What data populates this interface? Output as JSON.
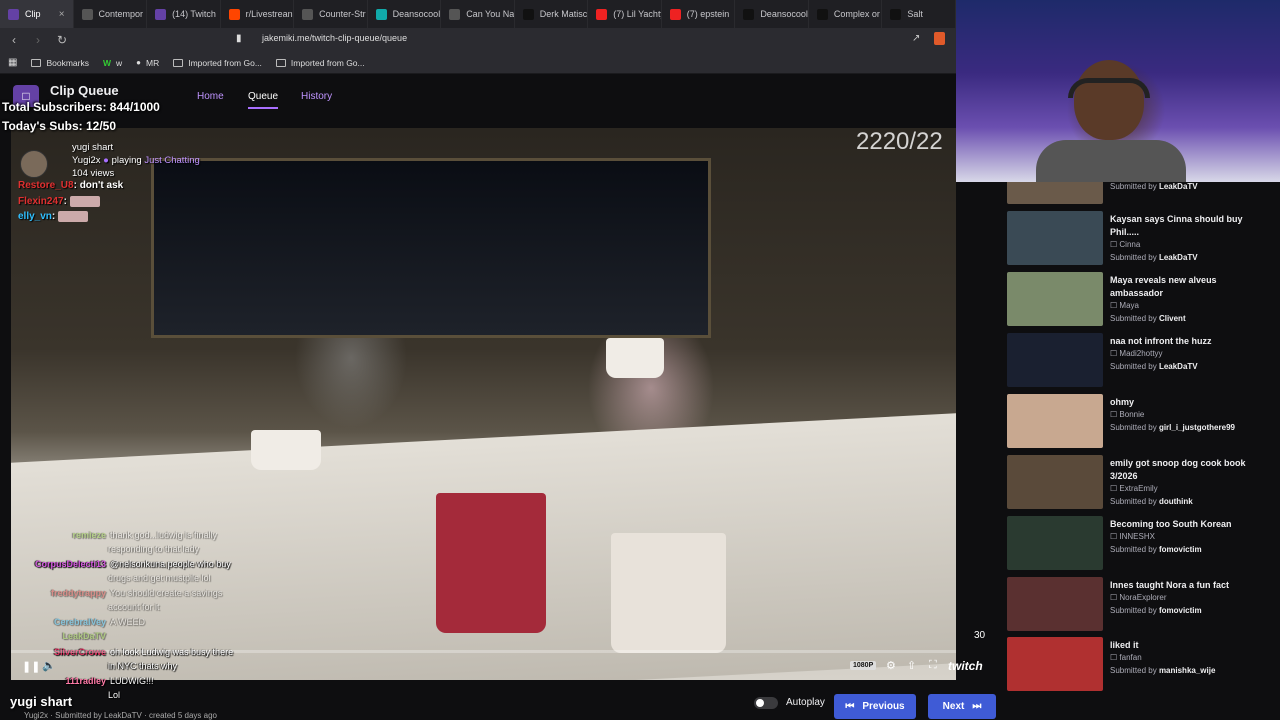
{
  "browser": {
    "tabs": [
      {
        "label": "Clip",
        "fav_color": "#6441a5",
        "active": true
      },
      {
        "label": "Contempor",
        "fav_color": "#555"
      },
      {
        "label": "(14) Twitch",
        "fav_color": "#6441a5"
      },
      {
        "label": "r/Livestrean",
        "fav_color": "#ff4500"
      },
      {
        "label": "Counter-Str",
        "fav_color": "#555"
      },
      {
        "label": "Deansocool",
        "fav_color": "#1aa"
      },
      {
        "label": "Can You Na",
        "fav_color": "#555"
      },
      {
        "label": "Derk Matisc",
        "fav_color": "#111"
      },
      {
        "label": "(7) Lil Yachty",
        "fav_color": "#e22"
      },
      {
        "label": "(7) epstein",
        "fav_color": "#e22"
      },
      {
        "label": "Deansocool",
        "fav_color": "#111"
      },
      {
        "label": "Complex or",
        "fav_color": "#111"
      },
      {
        "label": "Salt",
        "fav_color": "#111"
      }
    ],
    "url": "jakemiki.me/twitch-clip-queue/queue",
    "bookmarks": [
      {
        "label": "Bookmarks"
      },
      {
        "label": "w"
      },
      {
        "label": "MR"
      },
      {
        "label": "Imported from Go..."
      },
      {
        "label": "Imported from Go..."
      }
    ]
  },
  "app": {
    "title": "Clip Queue",
    "nav": {
      "home": "Home",
      "queue": "Queue",
      "history": "History"
    }
  },
  "overlay": {
    "total_subs": "Total Subscribers: 844/1000",
    "todays_subs": "Today's Subs: 12/50",
    "counter": "2220/22"
  },
  "clip": {
    "user": "yugi shart",
    "broadcaster": "Yugi2x",
    "playing_word": "playing",
    "game": "Just Chatting",
    "views": "104 views",
    "time_remaining": "30",
    "quality": "1080P",
    "progress_percent": 0,
    "footer_title": "yugi shart",
    "footer_meta": "Yugi2x · Submitted by LeakDaTV · created 5 days ago"
  },
  "chat_top": [
    {
      "name": "Restore_U8",
      "msg": "don't ask",
      "color": "#e03030"
    },
    {
      "name": "Flexin247",
      "msg": "",
      "color": "#e03030"
    },
    {
      "name": "elly_vn",
      "msg": "",
      "color": "#30c0ff"
    }
  ],
  "chat_bottom": [
    {
      "name": "remieze",
      "msg": "thank god...ludwig is finally",
      "color": "#8acd3a",
      "faded": true
    },
    {
      "name": "",
      "msg": "responding to that lady",
      "color": "#fff",
      "faded": true
    },
    {
      "name": "CorpusDelecti13",
      "msg": "@nelsonkuna people who buy",
      "color": "#d45ae0",
      "faded": false
    },
    {
      "name": "",
      "msg": "drugs and get mustpile lol",
      "color": "#fff",
      "faded": true
    },
    {
      "name": "freddytrappy",
      "msg": "You should create a savings",
      "color": "#e04040",
      "faded": true
    },
    {
      "name": "",
      "msg": "account for it",
      "color": "#fff",
      "faded": true
    },
    {
      "name": "CerebralVey",
      "msg": "A WEED",
      "color": "#30c0ff",
      "faded": true
    },
    {
      "name": "LeakDaTV",
      "msg": "",
      "color": "#8acd3a",
      "faded": true
    },
    {
      "name": "SilverCrowe",
      "msg": "oh look Ludwig was busy there",
      "color": "#e03060",
      "faded": false
    },
    {
      "name": "",
      "msg": "in NYC thats why",
      "color": "#fff",
      "faded": false
    },
    {
      "name": "111radley",
      "msg": "LUDWIG!!!",
      "color": "#ff7aa8",
      "faded": false
    },
    {
      "name": "",
      "msg": "Lol",
      "color": "#fff",
      "faded": false
    }
  ],
  "queue": [
    {
      "title": "",
      "author": "",
      "submitter": "LeakDaTV",
      "thumb": "#6a5a4a"
    },
    {
      "title": "Kaysan says Cinna should buy Phil.....",
      "author": "Cinna",
      "submitter": "LeakDaTV",
      "thumb": "#3a4a55"
    },
    {
      "title": "Maya reveals new alveus ambassador",
      "author": "Maya",
      "submitter": "Clivent",
      "thumb": "#7a8a6a"
    },
    {
      "title": "naa not infront the huzz",
      "author": "Madi2hottyy",
      "submitter": "LeakDaTV",
      "thumb": "#1a2030"
    },
    {
      "title": "ohmy",
      "author": "Bonnie",
      "submitter": "girl_i_justgothere99",
      "thumb": "#c8a890"
    },
    {
      "title": "emily got snoop dog cook book 3/2026",
      "author": "ExtraEmily",
      "submitter": "douthink",
      "thumb": "#5a4a3a"
    },
    {
      "title": "Becoming too South Korean",
      "author": "INNESHX",
      "submitter": "fomovictim",
      "thumb": "#2a3a30"
    },
    {
      "title": "Innes taught Nora a fun fact",
      "author": "NoraExplorer",
      "submitter": "fomovictim",
      "thumb": "#5a3030"
    },
    {
      "title": "liked it",
      "author": "fanfan",
      "submitter": "manishka_wije",
      "thumb": "#b03030"
    }
  ],
  "submitted_by_label": "Submitted by",
  "controls": {
    "autoplay": "Autoplay",
    "previous": "Previous",
    "next": "Next",
    "brand": "twitch"
  }
}
